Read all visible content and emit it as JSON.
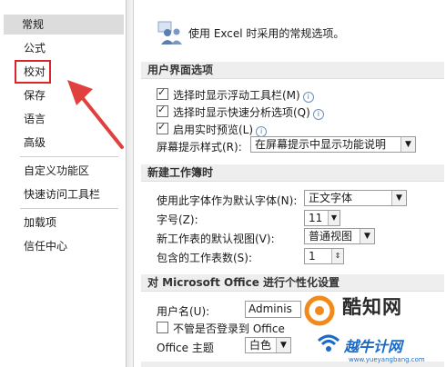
{
  "sidebar": {
    "items": [
      {
        "label": "常规"
      },
      {
        "label": "公式"
      },
      {
        "label": "校对"
      },
      {
        "label": "保存"
      },
      {
        "label": "语言"
      },
      {
        "label": "高级"
      },
      {
        "label": "自定义功能区"
      },
      {
        "label": "快速访问工具栏"
      },
      {
        "label": "加载项"
      },
      {
        "label": "信任中心"
      }
    ]
  },
  "main": {
    "header": "使用 Excel 时采用的常规选项。",
    "ui_section": {
      "title": "用户界面选项",
      "mini_toolbar": "选择时显示浮动工具栏(M)",
      "quick_analysis": "选择时显示快速分析选项(Q)",
      "live_preview": "启用实时预览(L)",
      "screentip_label": "屏幕提示样式(R):",
      "screentip_value": "在屏幕提示中显示功能说明"
    },
    "new_workbook": {
      "title": "新建工作簿时",
      "font_label": "使用此字体作为默认字体(N):",
      "font_value": "正文字体",
      "size_label": "字号(Z):",
      "size_value": "11",
      "view_label": "新工作表的默认视图(V):",
      "view_value": "普通视图",
      "sheets_label": "包含的工作表数(S):",
      "sheets_value": "1"
    },
    "personalize": {
      "title": "对 Microsoft Office 进行个性化设置",
      "username_label": "用户名(U):",
      "username_value": "Adminis",
      "always_use": "不管是否登录到 Office",
      "theme_label": "Office 主题",
      "theme_value": "白色"
    }
  },
  "watermark": {
    "brand": "酷知网",
    "site_cn": "越牛计网",
    "site_url": "www.yueyangbang.com"
  },
  "colors": {
    "highlight_box": "#d9262b",
    "arrow": "#e0413f",
    "section_bg": "#eeeeee",
    "selected_bg": "#dcdcdc"
  }
}
